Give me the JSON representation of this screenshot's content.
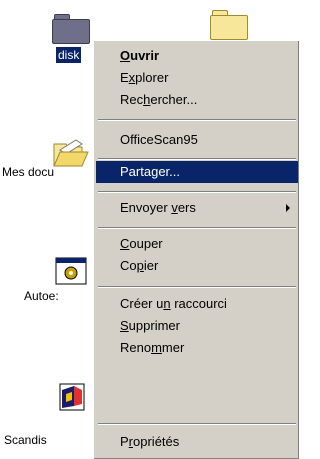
{
  "desktop": {
    "icons": [
      {
        "label": "disk",
        "selected": true,
        "icon": "folder-icon-grey"
      },
      {
        "label": "",
        "icon": "folder-icon-yellow"
      },
      {
        "label": "Mes docu",
        "icon": "open-folder-icon"
      },
      {
        "label": "Autoe:",
        "icon": "application-icon"
      },
      {
        "label": "Scandis",
        "icon": "scandisk-icon"
      }
    ]
  },
  "context_menu": {
    "items": [
      {
        "pre": "",
        "u": "O",
        "post": "uvrir",
        "default": true
      },
      {
        "pre": "E",
        "u": "x",
        "post": "plorer"
      },
      {
        "pre": "Rec",
        "u": "h",
        "post": "ercher..."
      },
      {
        "pre": "OfficeScan95",
        "u": "",
        "post": ""
      },
      {
        "pre": "Parta",
        "u": "g",
        "post": "er...",
        "highlighted": true
      },
      {
        "pre": "Envoyer ",
        "u": "v",
        "post": "ers",
        "submenu": true
      },
      {
        "pre": "",
        "u": "C",
        "post": "ouper"
      },
      {
        "pre": "Co",
        "u": "p",
        "post": "ier"
      },
      {
        "pre": "Créer u",
        "u": "n",
        "post": " raccourci"
      },
      {
        "pre": "",
        "u": "S",
        "post": "upprimer"
      },
      {
        "pre": "Reno",
        "u": "m",
        "post": "mer"
      },
      {
        "pre": "P",
        "u": "r",
        "post": "opriétés"
      }
    ]
  },
  "colors": {
    "highlight": "#0a246a",
    "menu_face": "#d4d0c8",
    "desktop": "#ffffff"
  }
}
